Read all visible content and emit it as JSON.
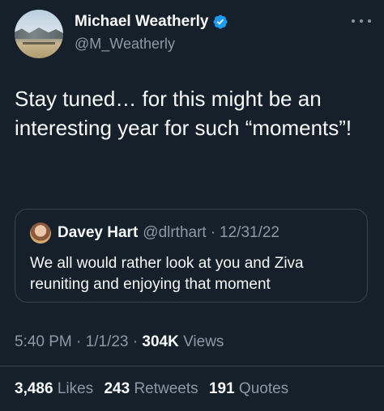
{
  "author": {
    "display_name": "Michael Weatherly",
    "handle": "@M_Weatherly",
    "verified": true
  },
  "tweet": {
    "text": "Stay tuned… for this might be an interesting year for such “moments”!"
  },
  "quoted_tweet": {
    "display_name": "Davey Hart",
    "handle": "@dlrthart",
    "separator": "·",
    "date": "12/31/22",
    "text": "We all would rather look at you and Ziva reuniting and enjoying that moment"
  },
  "meta": {
    "time": "5:40 PM",
    "separator": "·",
    "date": "1/1/23",
    "views_count": "304K",
    "views_label": "Views"
  },
  "stats": {
    "likes_count": "3,486",
    "likes_label": "Likes",
    "retweets_count": "243",
    "retweets_label": "Retweets",
    "quotes_count": "191",
    "quotes_label": "Quotes"
  },
  "colors": {
    "background": "#15202b",
    "primary_text": "#f7f9f9",
    "secondary_text": "#8b98a5",
    "verified_badge": "#1d9bf0",
    "border": "#38444d"
  },
  "icons": {
    "verified": "verified-badge-icon",
    "more": "more-options-icon"
  }
}
